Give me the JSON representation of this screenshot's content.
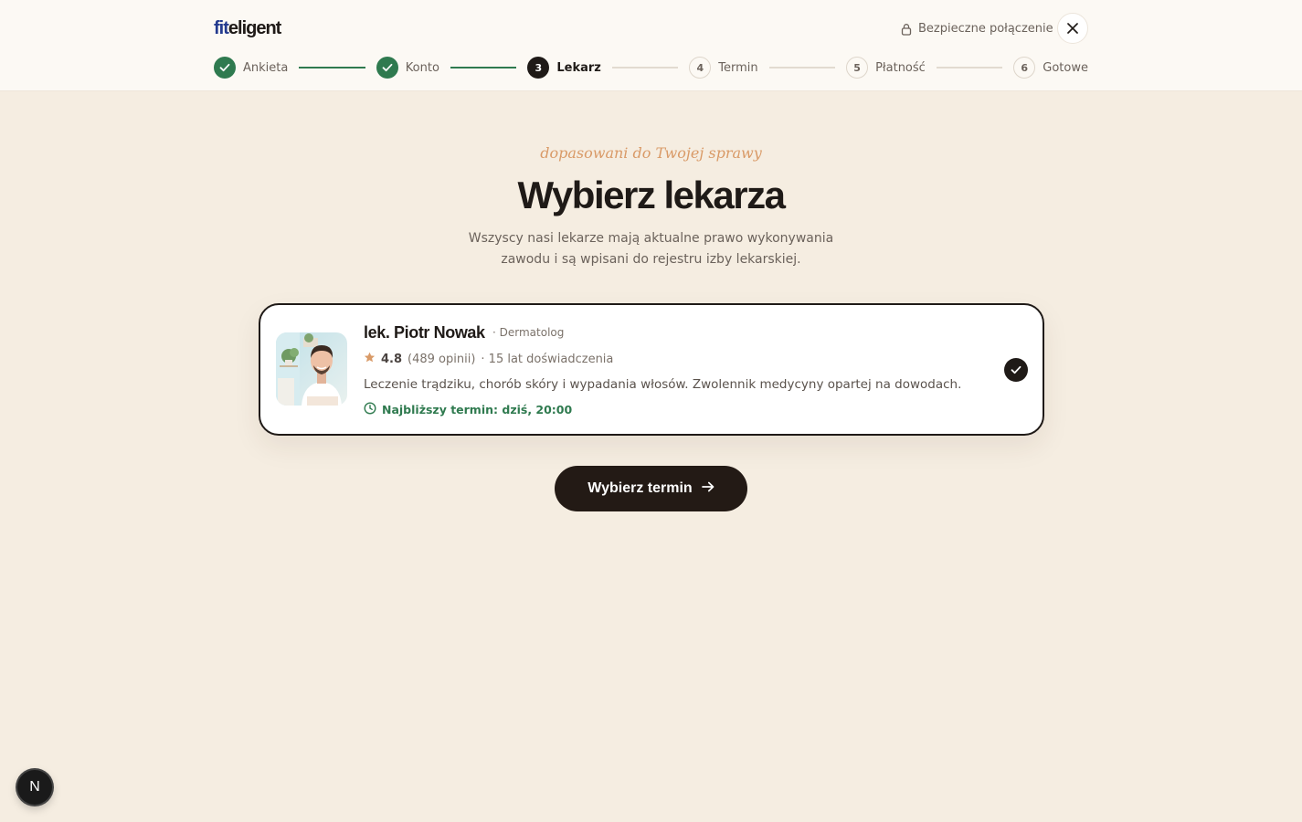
{
  "header": {
    "logo_part1": "fit",
    "logo_part2": "eligent",
    "secure_label": "Bezpieczne połączenie",
    "close_icon": "close-icon"
  },
  "steps": [
    {
      "number": "1",
      "label": "Ankieta",
      "state": "done"
    },
    {
      "number": "2",
      "label": "Konto",
      "state": "done"
    },
    {
      "number": "3",
      "label": "Lekarz",
      "state": "active"
    },
    {
      "number": "4",
      "label": "Termin",
      "state": "todo"
    },
    {
      "number": "5",
      "label": "Płatność",
      "state": "todo"
    },
    {
      "number": "6",
      "label": "Gotowe",
      "state": "todo"
    }
  ],
  "hero": {
    "eyebrow": "dopasowani do Twojej sprawy",
    "title": "Wybierz lekarza",
    "subtitle": "Wszyscy nasi lekarze mają aktualne prawo wykonywania zawodu i są wpisani do rejestru izby lekarskiej."
  },
  "doctor": {
    "name": "lek. Piotr Nowak",
    "specialty": "· Dermatolog",
    "rating": "4.8",
    "reviews": "(489 opinii)",
    "experience": "· 15 lat doświadczenia",
    "bio": "Leczenie trądziku, chorób skóry i wypadania włosów. Zwolennik medycyny opartej na dowodach.",
    "next_slot": "Najbliższy termin: dziś, 20:00",
    "selected": true
  },
  "cta": {
    "label": "Wybierz termin"
  },
  "dev_badge": {
    "label": "N"
  },
  "colors": {
    "background": "#f5ede1",
    "header": "#fcf9f4",
    "accent_green": "#2f7a4f",
    "dark": "#1f1a17",
    "eyebrow": "#d99a67",
    "logo_blue": "#233a8e"
  }
}
